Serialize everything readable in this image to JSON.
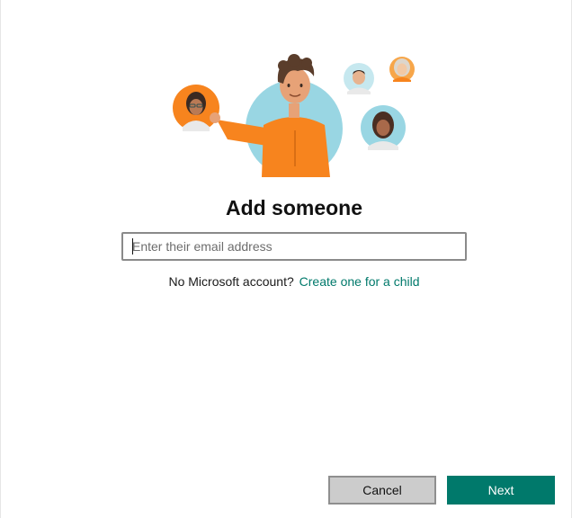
{
  "dialog": {
    "title": "Add someone",
    "email_placeholder": "Enter their email address",
    "email_value": "",
    "no_account_text": "No Microsoft account?",
    "create_child_link": "Create one for a child",
    "buttons": {
      "cancel_label": "Cancel",
      "next_label": "Next"
    }
  },
  "colors": {
    "accent": "#00796b",
    "cancel_bg": "#cccccc",
    "illustration_orange": "#f7841e",
    "illustration_blue": "#99d6e3"
  },
  "illustration": {
    "icon_name": "add-family-member-illustration"
  }
}
